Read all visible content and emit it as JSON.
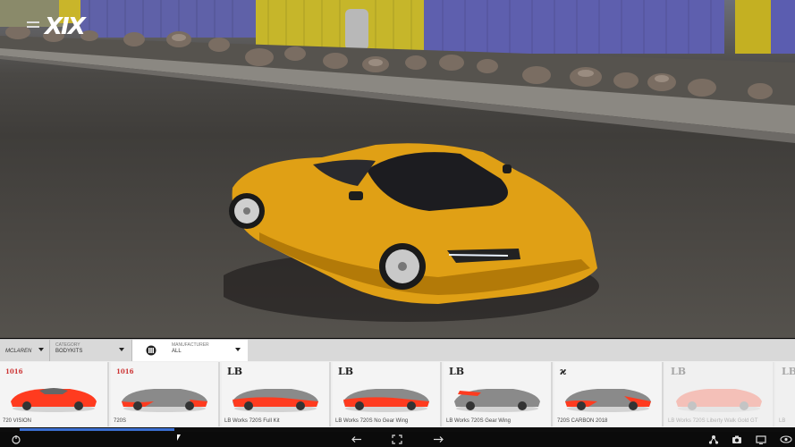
{
  "app": {
    "logo_text": "XIX",
    "menu_icon": "hamburger-icon"
  },
  "filters": {
    "brand": {
      "label": "McLaren",
      "icon": "mclaren-logo-icon"
    },
    "category": {
      "caption": "CATEGORY",
      "value": "BODYKITS"
    },
    "manufacturer": {
      "caption": "MANUFACTURER",
      "value": "ALL",
      "icon": "manufacturer-icon"
    }
  },
  "colors": {
    "accent": "#3b6fd1",
    "car_paint": "#e8a512",
    "kit_red": "#ff3b1f",
    "card_bg": "#f4f4f4"
  },
  "cards": [
    {
      "brand": "1016",
      "brand_icon": "1016-industries-logo-icon",
      "name": "720 VISION"
    },
    {
      "brand": "1016",
      "brand_icon": "1016-industries-logo-icon",
      "name": "720S"
    },
    {
      "brand": "LB",
      "brand_icon": "liberty-walk-logo-icon",
      "name": "LB Works 720S Full Kit"
    },
    {
      "brand": "LB",
      "brand_icon": "liberty-walk-logo-icon",
      "name": "LB Works 720S No Gear Wing"
    },
    {
      "brand": "LB",
      "brand_icon": "liberty-walk-logo-icon",
      "name": "LB Works 720S Gear Wing"
    },
    {
      "brand": "ϰ",
      "brand_icon": "carbon-logo-icon",
      "name": "720S CARBON 2018"
    },
    {
      "brand": "LB",
      "brand_icon": "liberty-walk-logo-icon",
      "name": "LB Works 720S Liberty Walk Gold GT"
    },
    {
      "brand": "LB",
      "brand_icon": "liberty-walk-logo-icon",
      "name": "LB"
    }
  ],
  "scroll": {
    "progress": 0.2
  },
  "taskbar": {
    "left_icon": "power-icon",
    "nav_icons": [
      "back-arrow-icon",
      "fullscreen-icon",
      "forward-arrow-icon"
    ],
    "right_icons": [
      "network-icon",
      "camera-icon",
      "screen-icon",
      "chevron-up-icon",
      "visibility-icon"
    ]
  }
}
